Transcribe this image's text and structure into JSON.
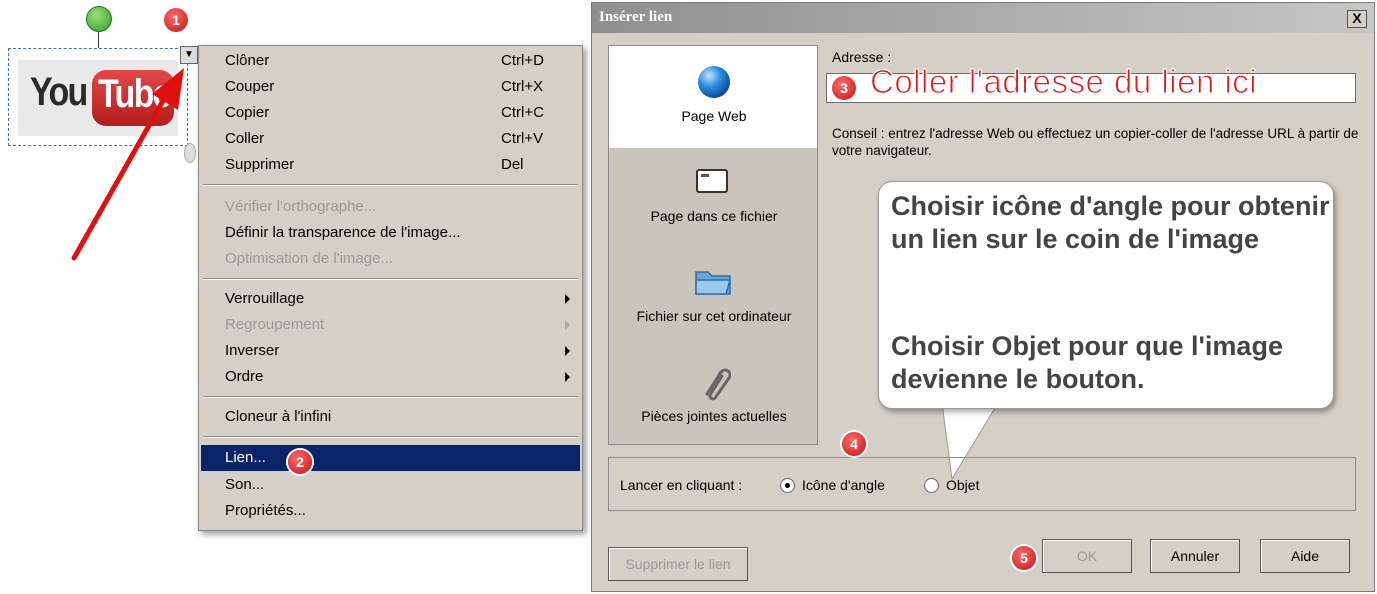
{
  "badges": {
    "b1": "1",
    "b2": "2",
    "b3": "3",
    "b4": "4",
    "b5": "5"
  },
  "image_object": {
    "logo_part1": "You",
    "logo_part2": "Tube",
    "menu_handle_glyph": "▼"
  },
  "context_menu": {
    "items": [
      {
        "label": "Clôner",
        "shortcut": "Ctrl+D",
        "enabled": true
      },
      {
        "label": "Couper",
        "shortcut": "Ctrl+X",
        "enabled": true
      },
      {
        "label": "Copier",
        "shortcut": "Ctrl+C",
        "enabled": true
      },
      {
        "label": "Coller",
        "shortcut": "Ctrl+V",
        "enabled": true
      },
      {
        "label": "Supprimer",
        "shortcut": "Del",
        "enabled": true
      },
      {
        "label": "Vérifier l'orthographe...",
        "enabled": false
      },
      {
        "label": "Définir la transparence de l'image...",
        "enabled": true
      },
      {
        "label": "Optimisation de l'image...",
        "enabled": false
      },
      {
        "label": "Verrouillage",
        "submenu": true,
        "enabled": true
      },
      {
        "label": "Regroupement",
        "submenu": true,
        "enabled": false
      },
      {
        "label": "Inverser",
        "submenu": true,
        "enabled": true
      },
      {
        "label": "Ordre",
        "submenu": true,
        "enabled": true
      },
      {
        "label": "Cloneur à l'infini",
        "enabled": true
      },
      {
        "label": "Lien...",
        "enabled": true,
        "highlighted": true
      },
      {
        "label": "Son...",
        "enabled": true
      },
      {
        "label": "Propriétés...",
        "enabled": true
      }
    ]
  },
  "dialog": {
    "title": "Insérer lien",
    "close_glyph": "X",
    "side_options": [
      "Page Web",
      "Page dans ce fichier",
      "Fichier sur cet ordinateur",
      "Pièces jointes actuelles"
    ],
    "address_label": "Adresse :",
    "address_hint": "Coller l'adresse du lien ici",
    "conseil": "Conseil : entrez l'adresse Web ou effectuez un copier-coller de l'adresse URL à partir de votre navigateur.",
    "launch_label": "Lancer en cliquant :",
    "radio_corner": "Icône d'angle",
    "radio_object": "Objet",
    "btn_remove": "Supprimer le lien",
    "btn_ok": "OK",
    "btn_cancel": "Annuler",
    "btn_help": "Aide"
  },
  "callout": {
    "text1": "Choisir icône d'angle pour obtenir un lien sur le coin de l'image",
    "text2": "Choisir Objet pour que l'image devienne le bouton."
  },
  "colors": {
    "accent_red": "#e11b1b",
    "menu_highlight": "#0a246a",
    "dialog_bg": "#d4d0c8"
  }
}
